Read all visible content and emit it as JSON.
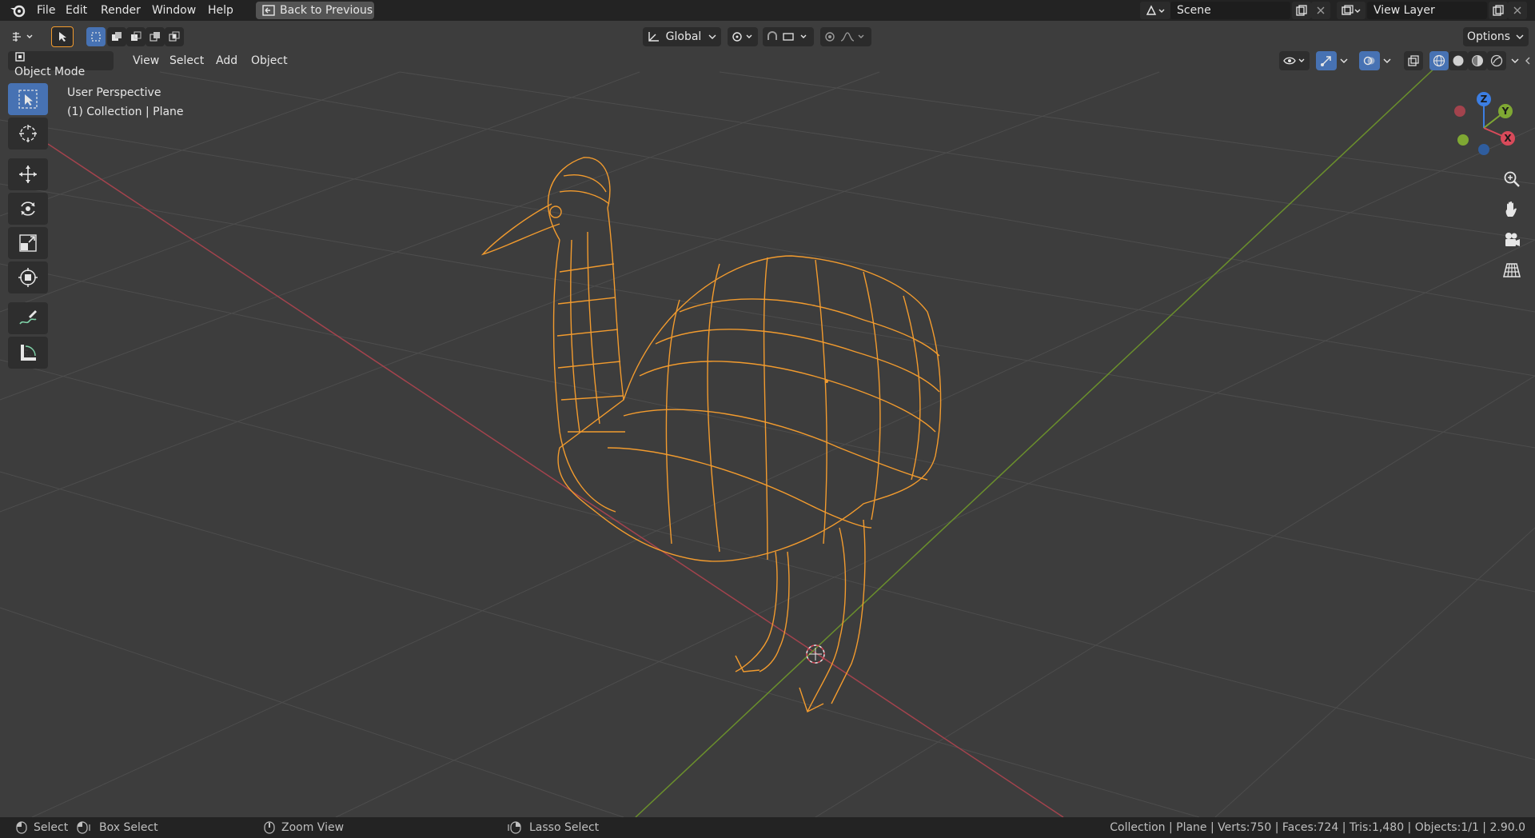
{
  "menubar": {
    "items": [
      "File",
      "Edit",
      "Render",
      "Window",
      "Help"
    ],
    "back_button": "Back to Previous",
    "scene": "Scene",
    "view_layer": "View Layer"
  },
  "toolheader": {
    "transform_orientation": "Global",
    "options": "Options"
  },
  "viewport_header": {
    "mode": "Object Mode",
    "menus": [
      "View",
      "Select",
      "Add",
      "Object"
    ]
  },
  "overlay": {
    "perspective": "User Perspective",
    "collection": "(1) Collection | Plane"
  },
  "gizmo": {
    "x": "X",
    "y": "Y",
    "z": "Z"
  },
  "statusbar": {
    "select": "Select",
    "box_select": "Box Select",
    "zoom_view": "Zoom View",
    "lasso_select": "Lasso Select",
    "stats": "Collection | Plane | Verts:750 | Faces:724 | Tris:1,480 | Objects:1/1 | 2.90.0"
  },
  "colors": {
    "background": "#3d3d3d",
    "topbar": "#232323",
    "accent": "#4772b3",
    "selection": "#f29b2e",
    "x_axis": "#d84a5a",
    "y_axis": "#7fa833",
    "z_axis": "#3c7ee3"
  },
  "icons": [
    "blender-logo-icon",
    "select-cursor-icon",
    "cursor-icon",
    "move-icon",
    "rotate-icon",
    "scale-icon",
    "transform-icon",
    "annotate-icon",
    "measure-icon",
    "zoom-icon",
    "hand-icon",
    "camera-icon",
    "grid-icon"
  ]
}
